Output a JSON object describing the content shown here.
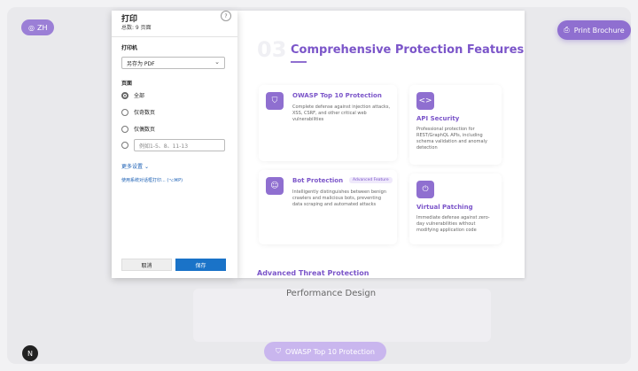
{
  "page": {
    "lang_label": "ZH",
    "print_brochure": "Print Brochure",
    "perf_text": "Performance Design",
    "owasp_pill": "OWASP Top 10 Protection",
    "n_badge": "N"
  },
  "preview": {
    "section_number": "03",
    "section_title": "Comprehensive Protection Features",
    "cards": [
      {
        "title": "OWASP Top 10 Protection",
        "desc": "Complete defense against injection attacks, XSS, CSRF, and other critical web vulnerabilities",
        "icon": "shield-icon"
      },
      {
        "title": "API Security",
        "desc": "Professional protection for REST/GraphQL APIs, including schema validation and anomaly detection",
        "icon": "code-icon"
      },
      {
        "title": "Bot Protection",
        "badge": "Advanced Feature",
        "desc": "Intelligently distinguishes between benign crawlers and malicious bots, preventing data scraping and automated attacks",
        "icon": "robot-icon"
      },
      {
        "title": "Virtual Patching",
        "desc": "Immediate defense against zero-day vulnerabilities without modifying application code",
        "icon": "power-icon"
      }
    ],
    "advanced_threat": "Advanced Threat Protection"
  },
  "dialog": {
    "title": "打印",
    "subtitle": "总数: 9 页面",
    "help": "?",
    "printer_label": "打印机",
    "printer_value": "另存为 PDF",
    "pages_label": "页面",
    "options": [
      "全部",
      "仅奇数页",
      "仅偶数页"
    ],
    "range_placeholder": "例如1-5、8、11-13",
    "more_settings": "更多设置",
    "system_dialog": "使用系统对话框打印... (⌥⌘P)",
    "cancel": "取消",
    "save": "保存"
  },
  "colors": {
    "accent": "#8f6fd0",
    "title": "#7b55c9",
    "save_button": "#1a73c8"
  }
}
